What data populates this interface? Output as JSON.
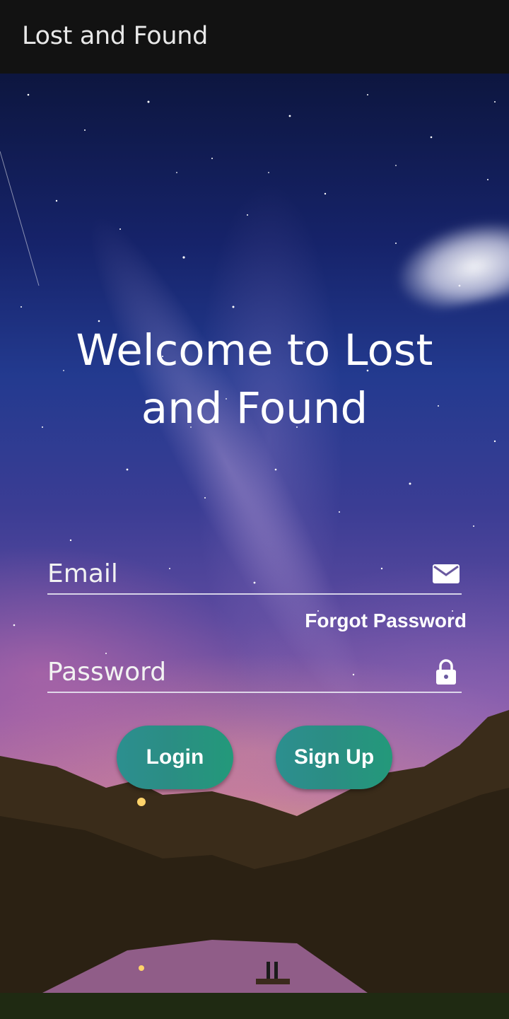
{
  "app_bar": {
    "title": "Lost and Found"
  },
  "main": {
    "welcome_text": "Welcome to Lost and Found",
    "email": {
      "placeholder": "Email",
      "value": "",
      "icon": "envelope-icon"
    },
    "forgot_password_label": "Forgot Password",
    "password": {
      "placeholder": "Password",
      "value": "",
      "icon": "lock-icon"
    },
    "login_label": "Login",
    "signup_label": "Sign Up"
  },
  "colors": {
    "app_bar": "#121212",
    "button_gradient_start": "#2c8f8f",
    "button_gradient_end": "#23997a",
    "text": "#ffffff"
  }
}
